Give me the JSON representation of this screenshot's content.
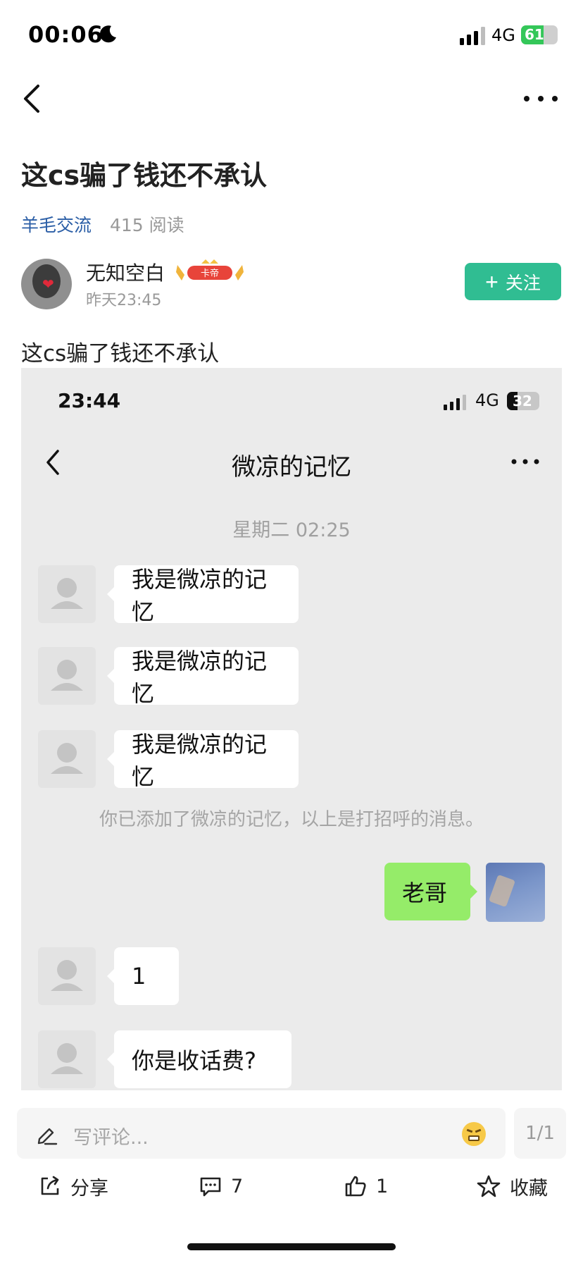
{
  "status_bar": {
    "time": "00:06",
    "network": "4G",
    "battery": "61",
    "battery_level": 0.61
  },
  "post": {
    "title": "这cs骗了钱还不承认",
    "group": "羊毛交流",
    "reads": "415 阅读",
    "author": {
      "name": "无知空白",
      "badge": "卡帝",
      "time": "昨天23:45"
    },
    "follow_label": "关注",
    "body": "这cs骗了钱还不承认"
  },
  "screenshot": {
    "time": "23:44",
    "network": "4G",
    "battery": "32",
    "battery_level": 0.32,
    "chat_title": "微凉的记忆",
    "date": "星期二 02:25",
    "messages": [
      {
        "text": "我是微凉的记忆"
      },
      {
        "text": "我是微凉的记忆"
      },
      {
        "text": "我是微凉的记忆"
      },
      {
        "text": "老哥"
      },
      {
        "text": "1"
      },
      {
        "text": "你是收话费?"
      }
    ],
    "system_note": "你已添加了微凉的记忆，以上是打招呼的消息。"
  },
  "comment": {
    "placeholder": "写评论...",
    "page": "1/1"
  },
  "actions": {
    "share": "分享",
    "comments": "7",
    "likes": "1",
    "favorite": "收藏"
  },
  "colors": {
    "accent": "#30bd92",
    "link": "#2b5ea6",
    "bubble_mine": "#95ec69"
  }
}
